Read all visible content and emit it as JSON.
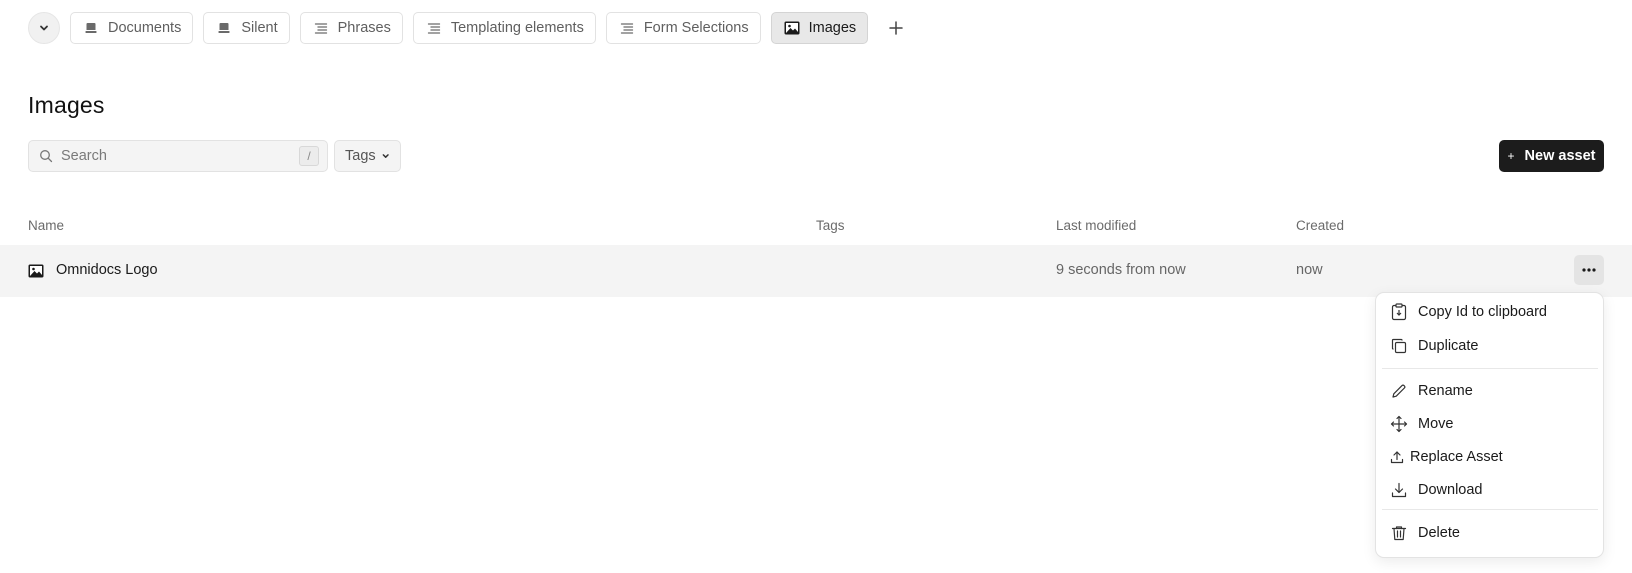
{
  "tabs": [
    {
      "label": "Documents",
      "icon": "stack-icon"
    },
    {
      "label": "Silent",
      "icon": "stack-icon"
    },
    {
      "label": "Phrases",
      "icon": "text-lines-icon"
    },
    {
      "label": "Templating elements",
      "icon": "text-lines-icon"
    },
    {
      "label": "Form Selections",
      "icon": "text-lines-icon"
    },
    {
      "label": "Images",
      "icon": "image-icon",
      "active": true
    }
  ],
  "page": {
    "title": "Images"
  },
  "toolbar": {
    "search_placeholder": "Search",
    "search_shortcut": "/",
    "tags_label": "Tags",
    "new_asset_plus": "+",
    "new_asset_label": "New asset"
  },
  "table": {
    "columns": [
      "Name",
      "Tags",
      "Last modified",
      "Created"
    ],
    "rows": [
      {
        "name": "Omnidocs Logo",
        "tags": "",
        "last_modified": "9 seconds from now",
        "created": "now"
      }
    ]
  },
  "context_menu": {
    "items": [
      {
        "label": "Copy Id to clipboard",
        "icon": "clipboard-icon"
      },
      {
        "label": "Duplicate",
        "icon": "duplicate-icon"
      },
      {
        "label": "Rename",
        "icon": "pencil-icon"
      },
      {
        "label": "Move",
        "icon": "move-arrows-icon"
      },
      {
        "label": "Replace Asset",
        "icon": "upload-icon"
      },
      {
        "label": "Download",
        "icon": "download-icon"
      },
      {
        "label": "Delete",
        "icon": "trash-icon"
      }
    ]
  },
  "colors": {
    "primary_button": "#1c1c1c",
    "row_highlight": "#f4f4f4",
    "active_tab": "#e8e8e8"
  }
}
